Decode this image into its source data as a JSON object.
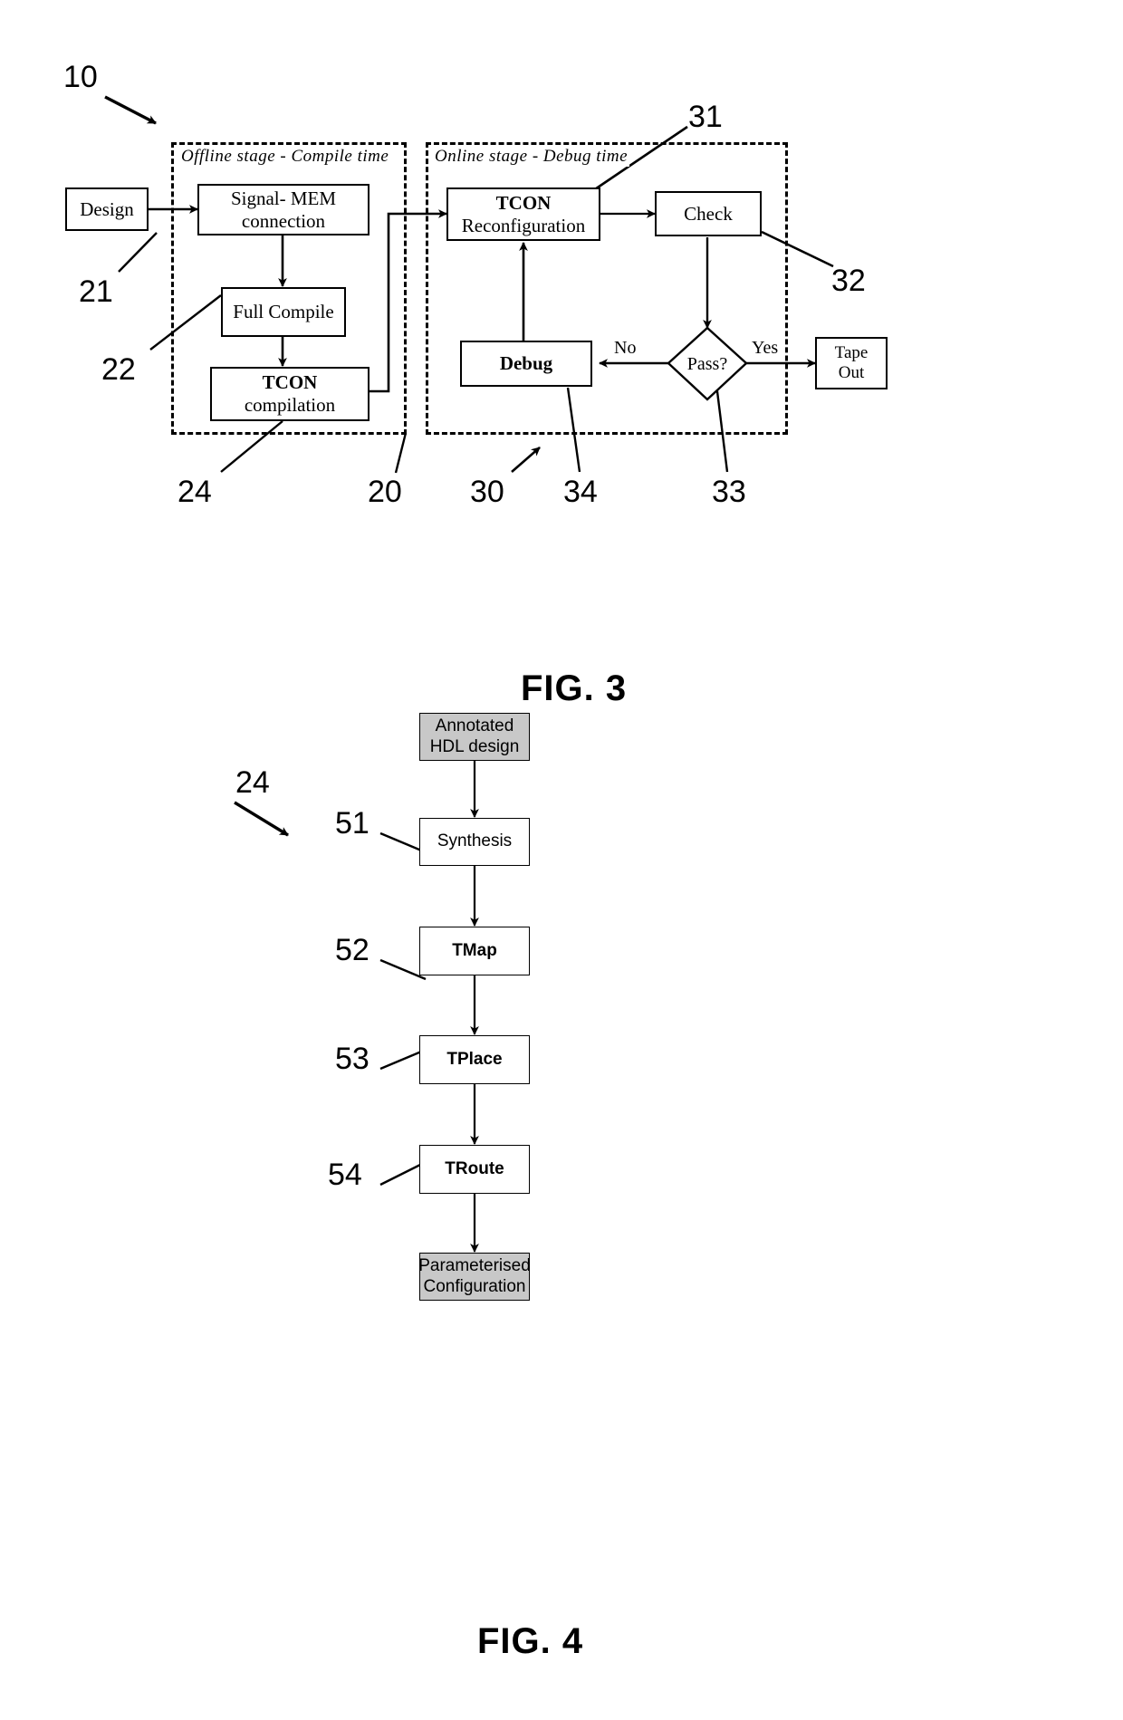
{
  "figures": [
    {
      "id": "fig3",
      "caption": "FIG. 3",
      "top_ref": "10",
      "stages": [
        {
          "id": "offline",
          "label": "Offline stage -  Compile time",
          "ref": "20"
        },
        {
          "id": "online",
          "label": "Online stage -  Debug time",
          "ref": "30"
        }
      ],
      "nodes": {
        "design": {
          "line1": "Design"
        },
        "signal_mem": {
          "line1": "Signal- MEM",
          "line2": "connection"
        },
        "full_compile": {
          "line1": "Full Compile"
        },
        "tcon_compilation": {
          "line1": "TCON",
          "line2": "compilation"
        },
        "tcon_reconfiguration": {
          "line1": "TCON",
          "line2": "Reconfiguration"
        },
        "check": {
          "line1": "Check"
        },
        "pass": {
          "line1": "Pass?"
        },
        "debug": {
          "line1": "Debug"
        },
        "tape_out": {
          "line1": "Tape",
          "line2": "Out"
        }
      },
      "edge_labels": {
        "no": "No",
        "yes": "Yes"
      },
      "refs": {
        "design": "21",
        "full_compile": "22",
        "tcon_compilation": "24",
        "offline_stage": "20",
        "tcon_reconfiguration": "31",
        "check": "32",
        "online_stage": "30",
        "debug": "34",
        "pass": "33"
      }
    },
    {
      "id": "fig4",
      "caption": "FIG. 4",
      "top_ref": "24",
      "nodes": {
        "annotated_hdl": {
          "line1": "Annotated",
          "line2": "HDL design"
        },
        "synthesis": {
          "line1": "Synthesis"
        },
        "tmap": {
          "line1": "TMap"
        },
        "tplace": {
          "line1": "TPlace"
        },
        "troute": {
          "line1": "TRoute"
        },
        "parameterised_config": {
          "line1": "Parameterised",
          "line2": "Configuration"
        }
      },
      "refs": {
        "synthesis": "51",
        "tmap": "52",
        "tplace": "53",
        "troute": "54"
      }
    }
  ],
  "colors": {
    "stroke": "#000000",
    "background": "#ffffff",
    "node_fill_gray": "#c8c8c8"
  }
}
